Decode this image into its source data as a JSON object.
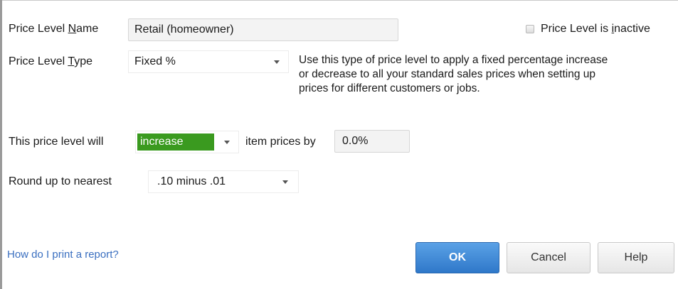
{
  "form": {
    "name": {
      "label_pre": "Price Level ",
      "label_key": "N",
      "label_post": "ame",
      "value": "Retail (homeowner)"
    },
    "inactive": {
      "label_pre": "Price Level is ",
      "label_key": "i",
      "label_post": "nactive",
      "checked": false
    },
    "type": {
      "label_pre": "Price Level ",
      "label_key": "T",
      "label_post": "ype",
      "value": "Fixed %",
      "description_lines": [
        "Use this type of price level to apply a fixed percentage increase",
        "or decrease to all your standard sales prices when setting up",
        "prices for different customers or jobs."
      ]
    },
    "adjust": {
      "prefix": "This price level will",
      "direction": "increase",
      "middle": "item prices by",
      "percent": "0.0%",
      "highlight_color": "#3a9a1f"
    },
    "rounding": {
      "label": "Round up to nearest",
      "value": ".10 minus .01"
    }
  },
  "footer": {
    "help_link": "How do I print a report?",
    "ok": "OK",
    "cancel": "Cancel",
    "help": "Help"
  }
}
